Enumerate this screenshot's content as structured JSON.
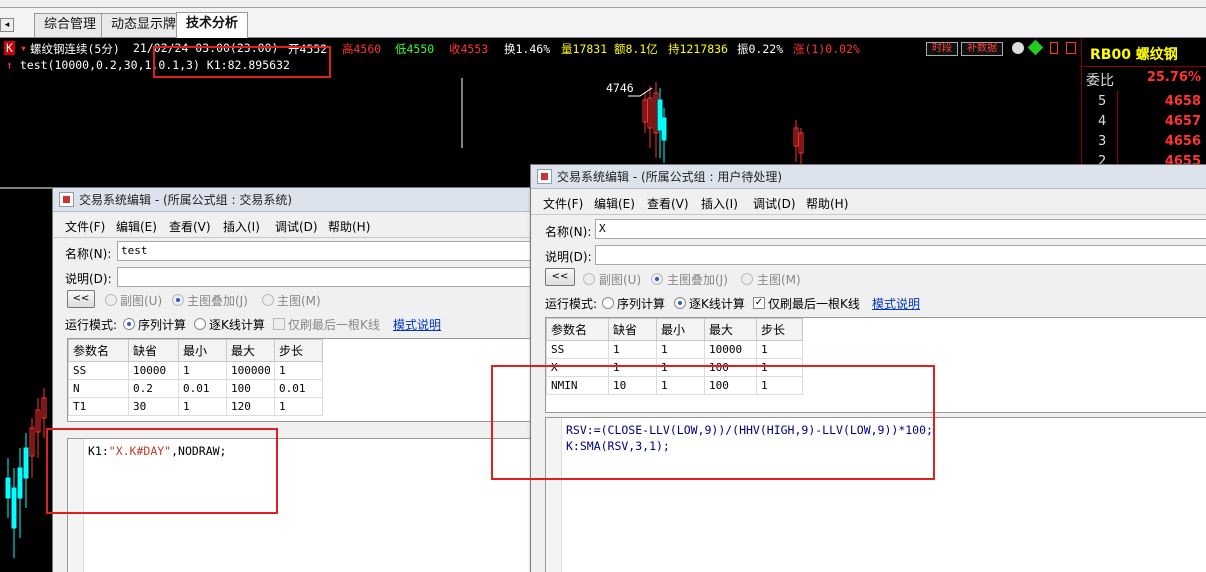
{
  "tabs": [
    {
      "label": "综合管理"
    },
    {
      "label": "动态显示牌"
    },
    {
      "label": "技术分析"
    }
  ],
  "chart": {
    "header": {
      "k_badge": "K",
      "symbol": "螺纹钢连续(5分)",
      "datetime": "21/02/24 03:00(23:00)",
      "open": "开4552",
      "high": "高4560",
      "low": "低4550",
      "close": "收4553",
      "turnover": "换1.46%",
      "volume": "量17831",
      "amount": "额8.1亿",
      "hold": "持1217836",
      "amplitude": "振0.22%",
      "change": "涨(1)0.02%",
      "btn_time": "时段",
      "btn_fill": "补数据"
    },
    "indicator_line": "test(10000,0.2,30,1,0.1,3) K1:82.895632",
    "price_label": "4746"
  },
  "right_panel": {
    "title": "RB00 螺纹钢",
    "weibi_label": "委比",
    "weibi_value": "25.76%",
    "rows": [
      {
        "level": "5",
        "price": "4658"
      },
      {
        "level": "4",
        "price": "4657"
      },
      {
        "level": "3",
        "price": "4656"
      },
      {
        "level": "2",
        "price": "4655"
      }
    ]
  },
  "win1": {
    "title": "交易系统编辑 - (所属公式组 : 交易系统)",
    "menu": [
      "文件(F)",
      "编辑(E)",
      "查看(V)",
      "插入(I)",
      "调试(D)",
      "帮助(H)"
    ],
    "name_label": "名称(N):",
    "name_value": "test",
    "desc_label": "说明(D):",
    "desc_value": "",
    "collapse_btn": "<<",
    "radio_sub": "副图(U)",
    "radio_overlay": "主图叠加(J)",
    "radio_main": "主图(M)",
    "mode_label": "运行模式:",
    "mode_seq": "序列计算",
    "mode_kline": "逐K线计算",
    "only_last": "仅刷最后一根K线",
    "mode_help": "模式说明",
    "param_headers": [
      "参数名",
      "缺省",
      "最小",
      "最大",
      "步长"
    ],
    "params": [
      [
        "SS",
        "10000",
        "1",
        "100000",
        "1"
      ],
      [
        "N",
        "0.2",
        "0.01",
        "100",
        "0.01"
      ],
      [
        "T1",
        "30",
        "1",
        "120",
        "1"
      ]
    ],
    "code_prefix": "K1:",
    "code_str": "\"X.K#DAY\"",
    "code_suffix": ",NODRAW;"
  },
  "win2": {
    "title": "交易系统编辑 - (所属公式组 : 用户待处理)",
    "menu": [
      "文件(F)",
      "编辑(E)",
      "查看(V)",
      "插入(I)",
      "调试(D)",
      "帮助(H)"
    ],
    "name_label": "名称(N):",
    "name_value": "X",
    "desc_label": "说明(D):",
    "desc_value": "",
    "collapse_btn": "<<",
    "radio_sub": "副图(U)",
    "radio_overlay": "主图叠加(J)",
    "radio_main": "主图(M)",
    "mode_label": "运行模式:",
    "mode_seq": "序列计算",
    "mode_kline": "逐K线计算",
    "only_last": "仅刷最后一根K线",
    "mode_help": "模式说明",
    "param_headers": [
      "参数名",
      "缺省",
      "最小",
      "最大",
      "步长"
    ],
    "params": [
      [
        "SS",
        "1",
        "1",
        "10000",
        "1"
      ],
      [
        "X",
        "1",
        "1",
        "100",
        "1"
      ],
      [
        "NMIN",
        "10",
        "1",
        "100",
        "1"
      ]
    ],
    "code_line1": "RSV:=(CLOSE-LLV(LOW,9))/(HHV(HIGH,9)-LLV(LOW,9))*100;",
    "code_line2": "K:SMA(RSV,3,1);"
  }
}
